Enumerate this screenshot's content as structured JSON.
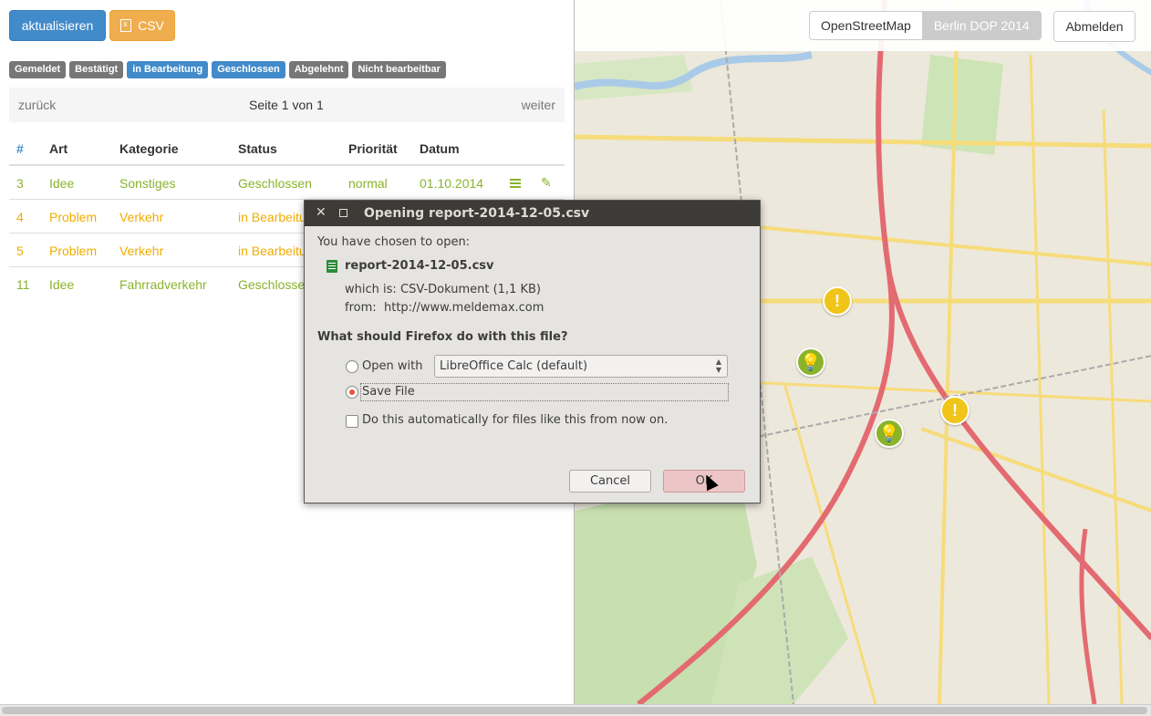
{
  "toolbar": {
    "refresh_label": "aktualisieren",
    "csv_label": "CSV"
  },
  "status_badges": [
    {
      "label": "Gemeldet",
      "color": "#777777"
    },
    {
      "label": "Bestätigt",
      "color": "#777777"
    },
    {
      "label": "in Bearbeitung",
      "color": "#428bca"
    },
    {
      "label": "Geschlossen",
      "color": "#428bca"
    },
    {
      "label": "Abgelehnt",
      "color": "#777777"
    },
    {
      "label": "Nicht bearbeitbar",
      "color": "#777777"
    }
  ],
  "pager": {
    "prev": "zurück",
    "info": "Seite 1 von 1",
    "next": "weiter"
  },
  "table": {
    "headers": [
      "#",
      "Art",
      "Kategorie",
      "Status",
      "Priorität",
      "Datum"
    ],
    "rows": [
      {
        "id": "3",
        "art": "Idee",
        "kategorie": "Sonstiges",
        "status": "Geschlossen",
        "prioritaet": "normal",
        "datum": "01.10.2014"
      },
      {
        "id": "4",
        "art": "Problem",
        "kategorie": "Verkehr",
        "status": "in Bearbeitung",
        "prioritaet": "",
        "datum": ""
      },
      {
        "id": "5",
        "art": "Problem",
        "kategorie": "Verkehr",
        "status": "in Bearbeitung",
        "prioritaet": "",
        "datum": ""
      },
      {
        "id": "11",
        "art": "Idee",
        "kategorie": "Fahrradverkehr",
        "status": "Geschlossen",
        "prioritaet": "",
        "datum": ""
      }
    ]
  },
  "map": {
    "layers": [
      "OpenStreetMap",
      "Berlin DOP 2014"
    ],
    "active_layer": "OpenStreetMap",
    "logout_label": "Abmelden",
    "markers": [
      {
        "type": "problem",
        "icon": "exclamation-icon"
      },
      {
        "type": "idea",
        "icon": "lightbulb-icon"
      },
      {
        "type": "problem",
        "icon": "exclamation-icon"
      },
      {
        "type": "idea",
        "icon": "lightbulb-icon"
      }
    ]
  },
  "dialog": {
    "title": "Opening report-2014-12-05.csv",
    "chosen_text": "You have chosen to open:",
    "filename": "report-2014-12-05.csv",
    "which_is_label": "which is:",
    "which_is_value": "CSV-Dokument (1,1 KB)",
    "from_label": "from:",
    "from_value": "http://www.meldemax.com",
    "question": "What should Firefox do with this file?",
    "open_with_label": "Open with",
    "open_with_app": "LibreOffice Calc (default)",
    "save_file_label": "Save File",
    "selected_option": "Save File",
    "auto_label": "Do this automatically for files like this from now on.",
    "auto_checked": false,
    "cancel_label": "Cancel",
    "ok_label": "OK"
  }
}
